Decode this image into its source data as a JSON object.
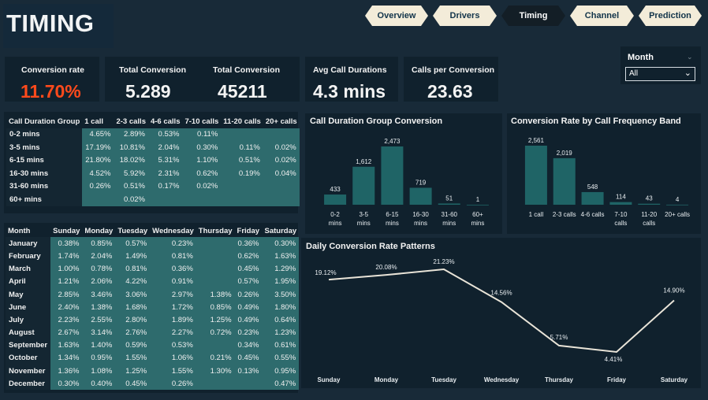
{
  "page_title": "TIMING",
  "nav": [
    {
      "label": "Overview",
      "active": false
    },
    {
      "label": "Drivers",
      "active": false
    },
    {
      "label": "Timing",
      "active": true
    },
    {
      "label": "Channel",
      "active": false
    },
    {
      "label": "Prediction",
      "active": false
    }
  ],
  "kpis": {
    "conversion_rate": {
      "label": "Conversion rate",
      "value": "11.70%"
    },
    "total_conversion_1": {
      "label": "Total Conversion",
      "value": "5.289"
    },
    "total_conversion_2": {
      "label": "Total Conversion",
      "value": "45211"
    },
    "avg_call_duration": {
      "label": "Avg Call Durations",
      "value": "4.3 mins"
    },
    "calls_per_conversion": {
      "label": "Calls per Conversion",
      "value": "23.63"
    }
  },
  "slicer": {
    "label": "Month",
    "value": "All"
  },
  "duration_matrix": {
    "columns": [
      "Call Duration Group",
      "1 call",
      "2-3 calls",
      "4-6 calls",
      "7-10 calls",
      "11-20 calls",
      "20+ calls"
    ],
    "rows": [
      {
        "label": "0-2 mins",
        "cells": [
          "4.65%",
          "2.89%",
          "0.53%",
          "0.11%",
          "",
          ""
        ]
      },
      {
        "label": "3-5 mins",
        "cells": [
          "17.19%",
          "10.81%",
          "2.04%",
          "0.30%",
          "0.11%",
          "0.02%"
        ]
      },
      {
        "label": "6-15 mins",
        "cells": [
          "21.80%",
          "18.02%",
          "5.31%",
          "1.10%",
          "0.51%",
          "0.02%"
        ]
      },
      {
        "label": "16-30 mins",
        "cells": [
          "4.52%",
          "5.92%",
          "2.31%",
          "0.62%",
          "0.19%",
          "0.04%"
        ]
      },
      {
        "label": "31-60 mins",
        "cells": [
          "0.26%",
          "0.51%",
          "0.17%",
          "0.02%",
          "",
          ""
        ]
      },
      {
        "label": "60+ mins",
        "cells": [
          "",
          "0.02%",
          "",
          "",
          "",
          ""
        ]
      }
    ]
  },
  "month_matrix": {
    "columns": [
      "Month",
      "Sunday",
      "Monday",
      "Tuesday",
      "Wednesday",
      "Thursday",
      "Friday",
      "Saturday"
    ],
    "rows": [
      {
        "label": "January",
        "cells": [
          "0.38%",
          "0.85%",
          "0.57%",
          "0.23%",
          "",
          "0.36%",
          "0.30%"
        ]
      },
      {
        "label": "February",
        "cells": [
          "1.74%",
          "2.04%",
          "1.49%",
          "0.81%",
          "",
          "0.62%",
          "1.63%"
        ]
      },
      {
        "label": "March",
        "cells": [
          "1.00%",
          "0.78%",
          "0.81%",
          "0.36%",
          "",
          "0.45%",
          "1.29%"
        ]
      },
      {
        "label": "April",
        "cells": [
          "1.21%",
          "2.06%",
          "4.22%",
          "0.91%",
          "",
          "0.57%",
          "1.95%"
        ]
      },
      {
        "label": "May",
        "cells": [
          "2.85%",
          "3.46%",
          "3.06%",
          "2.97%",
          "1.38%",
          "0.26%",
          "3.50%"
        ]
      },
      {
        "label": "June",
        "cells": [
          "2.40%",
          "1.38%",
          "1.68%",
          "1.72%",
          "0.85%",
          "0.49%",
          "1.80%"
        ]
      },
      {
        "label": "July",
        "cells": [
          "2.23%",
          "2.55%",
          "2.80%",
          "1.89%",
          "1.25%",
          "0.49%",
          "0.64%"
        ]
      },
      {
        "label": "August",
        "cells": [
          "2.67%",
          "3.14%",
          "2.76%",
          "2.27%",
          "0.72%",
          "0.23%",
          "1.23%"
        ]
      },
      {
        "label": "September",
        "cells": [
          "1.63%",
          "1.40%",
          "0.59%",
          "0.53%",
          "",
          "0.34%",
          "0.61%"
        ]
      },
      {
        "label": "October",
        "cells": [
          "1.34%",
          "0.95%",
          "1.55%",
          "1.06%",
          "0.21%",
          "0.45%",
          "0.55%"
        ]
      },
      {
        "label": "November",
        "cells": [
          "1.36%",
          "1.08%",
          "1.25%",
          "1.55%",
          "1.30%",
          "0.13%",
          "0.95%"
        ]
      },
      {
        "label": "December",
        "cells": [
          "0.30%",
          "0.40%",
          "0.45%",
          "0.26%",
          "",
          "",
          "0.47%"
        ]
      }
    ]
  },
  "colors": {
    "bar": "#1f6466",
    "line": "#e9e4d8",
    "accent_red": "#ff4a1c"
  },
  "chart_data": [
    {
      "type": "bar",
      "title": "Call Duration Group Conversion",
      "categories": [
        "0-2 mins",
        "3-5 mins",
        "6-15 mins",
        "16-30 mins",
        "31-60 mins",
        "60+ mins"
      ],
      "values": [
        433,
        1612,
        2473,
        719,
        51,
        1
      ],
      "labels": [
        "433",
        "1,612",
        "2,473",
        "719",
        "51",
        "1"
      ]
    },
    {
      "type": "bar",
      "title": "Conversion Rate by Call Frequency Band",
      "categories": [
        "1 call",
        "2-3 calls",
        "4-6 calls",
        "7-10 calls",
        "11-20 calls",
        "20+ calls"
      ],
      "values": [
        2561,
        2019,
        548,
        114,
        43,
        4
      ],
      "labels": [
        "2,561",
        "2,019",
        "548",
        "114",
        "43",
        "4"
      ]
    },
    {
      "type": "line",
      "title": "Daily Conversion Rate Patterns",
      "categories": [
        "Sunday",
        "Monday",
        "Tuesday",
        "Wednesday",
        "Thursday",
        "Friday",
        "Saturday"
      ],
      "values": [
        19.12,
        20.08,
        21.23,
        14.56,
        5.71,
        4.41,
        14.9
      ],
      "labels": [
        "19.12%",
        "20.08%",
        "21.23%",
        "14.56%",
        "5.71%",
        "4.41%",
        "14.90%"
      ]
    }
  ]
}
